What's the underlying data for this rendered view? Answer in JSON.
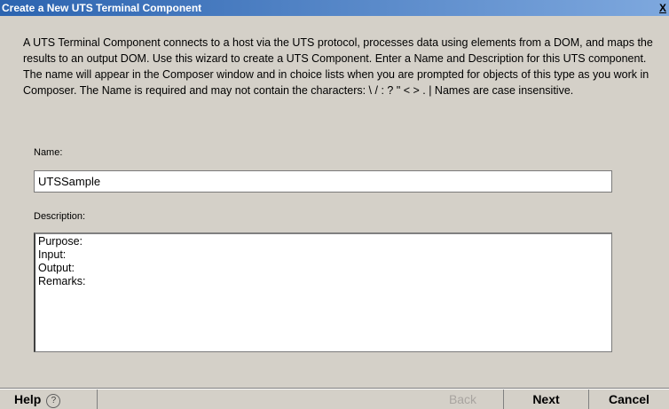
{
  "window": {
    "title": "Create a New UTS Terminal Component",
    "close_label": "X"
  },
  "intro_text": "A UTS Terminal Component connects to a host via the UTS protocol, processes data using elements from a DOM, and maps the results to an output DOM.  Use this wizard to create a UTS Component.  Enter a Name and Description for this UTS component.  The name will appear in the Composer window and in choice lists when you are prompted for objects of this type as you work in Composer.  The Name is required and may not contain the characters: \\ / : ? \" < > . |  Names are case insensitive.",
  "name_field": {
    "label": "Name:",
    "value": "UTSSample"
  },
  "description_field": {
    "label": "Description:",
    "value": "Purpose:\nInput:\nOutput:\nRemarks:"
  },
  "buttons": {
    "help": "Help",
    "help_icon": "?",
    "back": "Back",
    "next": "Next",
    "cancel": "Cancel"
  }
}
